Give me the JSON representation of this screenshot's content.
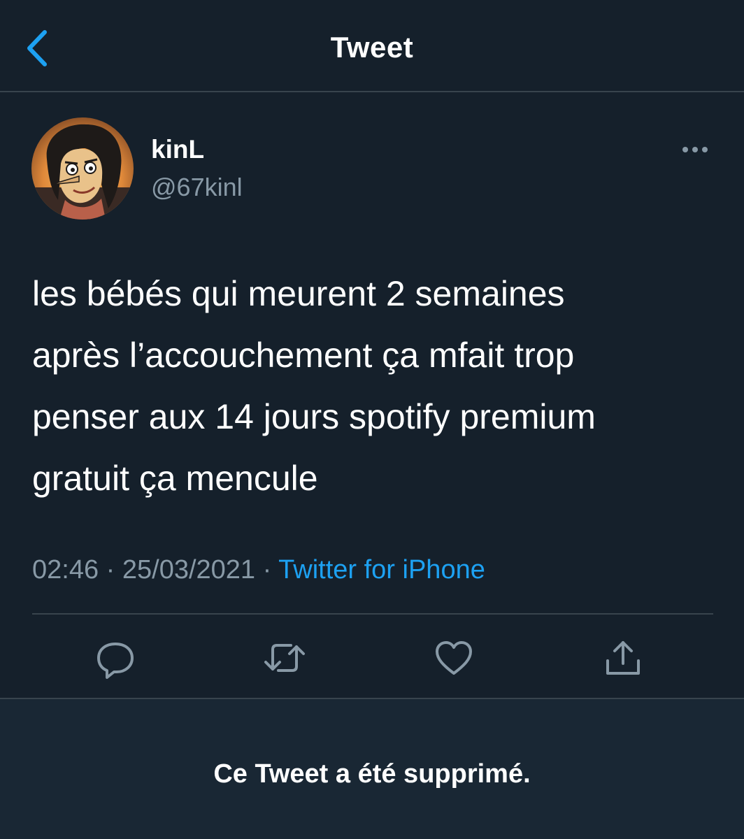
{
  "header": {
    "title": "Tweet",
    "back_icon": "chevron-left-icon"
  },
  "tweet": {
    "author": {
      "display_name": "kinL",
      "handle": "@67kinl",
      "avatar": "cartoon-avatar"
    },
    "text_lines": [
      "les bébés qui meurent 2 semaines",
      "après l’accouchement ça mfait trop",
      "penser aux 14 jours spotify premium",
      "gratuit ça mencule"
    ],
    "time": "02:46",
    "separator": "·",
    "date": "25/03/2021",
    "source": "Twitter for iPhone"
  },
  "actions": [
    {
      "name": "reply",
      "icon": "reply-icon"
    },
    {
      "name": "retweet",
      "icon": "retweet-icon"
    },
    {
      "name": "like",
      "icon": "heart-icon"
    },
    {
      "name": "share",
      "icon": "share-icon"
    }
  ],
  "deleted_notice": "Ce Tweet a été supprimé.",
  "colors": {
    "background": "#15202b",
    "panel": "#192734",
    "border": "#38444d",
    "secondary_text": "#8899a6",
    "accent": "#1da1f2"
  }
}
